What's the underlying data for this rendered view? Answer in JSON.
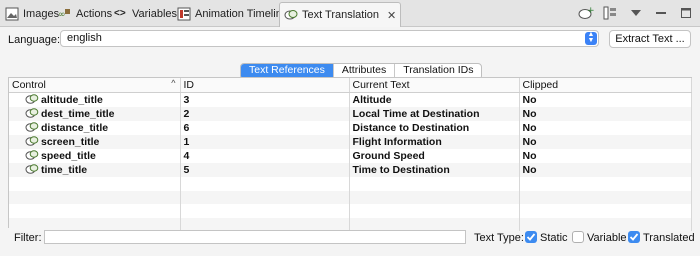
{
  "tabs": [
    {
      "label": "Images",
      "icon": "image-icon"
    },
    {
      "label": "Actions",
      "icon": "actions-icon"
    },
    {
      "label": "Variables",
      "icon": "variables-icon"
    },
    {
      "label": "Animation Timeline",
      "icon": "timeline-icon"
    },
    {
      "label": "Text Translation",
      "icon": "translation-icon",
      "active": true
    }
  ],
  "language": {
    "label": "Language:",
    "value": "english"
  },
  "extract_button": "Extract Text ...",
  "subtabs": [
    "Text References",
    "Attributes",
    "Translation IDs"
  ],
  "table": {
    "columns": [
      "Control",
      "ID",
      "Current Text",
      "Clipped"
    ],
    "rows": [
      {
        "control": "altitude_title",
        "id": "3",
        "text": "Altitude",
        "clipped": "No"
      },
      {
        "control": "dest_time_title",
        "id": "2",
        "text": "Local Time at Destination",
        "clipped": "No"
      },
      {
        "control": "distance_title",
        "id": "6",
        "text": "Distance to Destination",
        "clipped": "No"
      },
      {
        "control": "screen_title",
        "id": "1",
        "text": "Flight Information",
        "clipped": "No"
      },
      {
        "control": "speed_title",
        "id": "4",
        "text": "Ground Speed",
        "clipped": "No"
      },
      {
        "control": "time_title",
        "id": "5",
        "text": "Time to Destination",
        "clipped": "No"
      }
    ]
  },
  "filter": {
    "label": "Filter:",
    "value": ""
  },
  "text_type": {
    "label": "Text Type:",
    "options": [
      {
        "label": "Static",
        "checked": true
      },
      {
        "label": "Variable",
        "checked": false
      },
      {
        "label": "Translated",
        "checked": true
      }
    ]
  },
  "colors": {
    "accent": "#3d8bf0"
  }
}
